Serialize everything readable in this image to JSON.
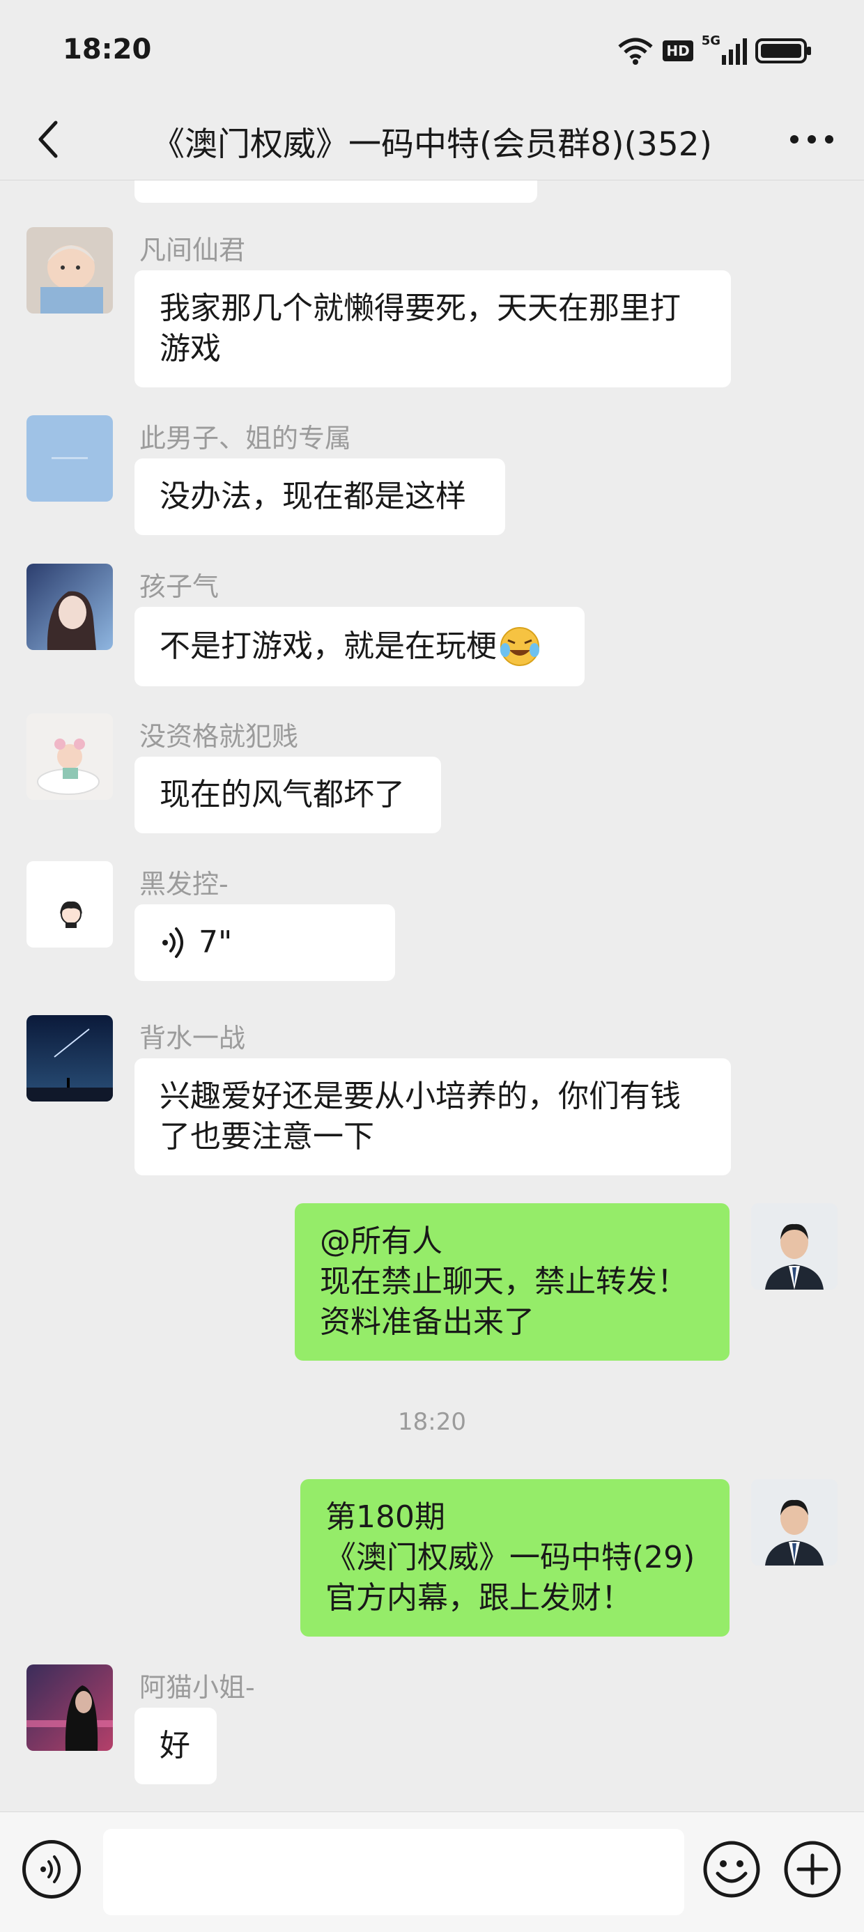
{
  "status": {
    "time": "18:20",
    "hd": "HD",
    "network": "5G"
  },
  "header": {
    "title": "《澳门权威》一码中特(会员群8)(352)"
  },
  "messages": [
    {
      "sender": "凡间仙君",
      "lines": [
        "我家那几个就懒得要死，天天在那里打",
        "游戏"
      ]
    },
    {
      "sender": "此男子、姐的专属",
      "lines": [
        "没办法，现在都是这样"
      ]
    },
    {
      "sender": "孩子气",
      "lines": [
        "不是打游戏，就是在玩梗"
      ]
    },
    {
      "sender": "没资格就犯贱",
      "lines": [
        "现在的风气都坏了"
      ]
    },
    {
      "sender": "黑发控-",
      "voice": "7\""
    },
    {
      "sender": "背水一战",
      "lines": [
        "兴趣爱好还是要从小培养的，你们有钱",
        "了也要注意一下"
      ]
    },
    {
      "self": true,
      "lines": [
        "@所有人",
        "现在禁止聊天，禁止转发！",
        "资料准备出来了"
      ]
    },
    {
      "self": true,
      "lines": [
        "第180期",
        "《澳门权威》一码中特(29)",
        "官方内幕，跟上发财！"
      ]
    },
    {
      "sender": "阿猫小姐-",
      "lines": [
        "好"
      ]
    }
  ],
  "time_separator": "18:20",
  "colors": {
    "background": "#ededed",
    "self_bubble": "#95ec69",
    "other_bubble": "#ffffff",
    "sender_name": "#9b9b9b"
  },
  "icons": [
    "back-arrow-icon",
    "more-icon",
    "wifi-icon",
    "signal-icon",
    "battery-icon",
    "voice-icon",
    "emoji-icon",
    "plus-icon"
  ]
}
